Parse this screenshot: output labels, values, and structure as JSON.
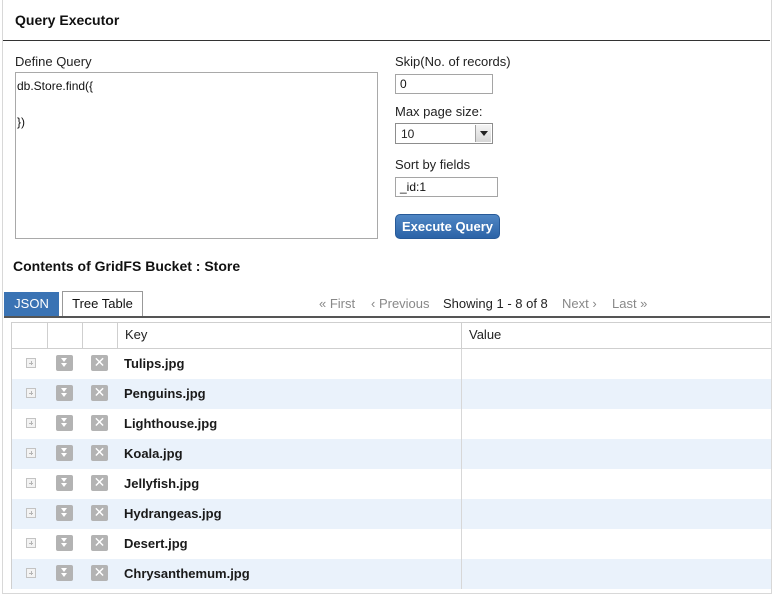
{
  "page": {
    "title": "Query Executor"
  },
  "query": {
    "define_label": "Define Query",
    "text": "db.Store.find({\n\n})",
    "skip_label": "Skip(No. of records)",
    "skip_value": "0",
    "max_page_label": "Max page size:",
    "max_page_value": "10",
    "sort_label": "Sort by fields",
    "sort_value": "_id:1",
    "execute_label": "Execute Query"
  },
  "results": {
    "section_title": "Contents of GridFS Bucket : Store",
    "tabs": [
      {
        "label": "JSON",
        "active": true
      },
      {
        "label": "Tree Table",
        "active": false
      }
    ],
    "pager": {
      "first": "« First",
      "previous": "‹ Previous",
      "status": "Showing 1 - 8 of 8",
      "next": "Next ›",
      "last": "Last »"
    },
    "columns": {
      "key": "Key",
      "value": "Value"
    },
    "rows": [
      {
        "key": "Tulips.jpg",
        "value": ""
      },
      {
        "key": "Penguins.jpg",
        "value": ""
      },
      {
        "key": "Lighthouse.jpg",
        "value": ""
      },
      {
        "key": "Koala.jpg",
        "value": ""
      },
      {
        "key": "Jellyfish.jpg",
        "value": ""
      },
      {
        "key": "Hydrangeas.jpg",
        "value": ""
      },
      {
        "key": "Desert.jpg",
        "value": ""
      },
      {
        "key": "Chrysanthemum.jpg",
        "value": ""
      }
    ],
    "row_icons": {
      "expand": "expand-icon",
      "download": "download-icon",
      "delete": "delete-icon",
      "delete_glyph": "✕"
    }
  },
  "colors": {
    "accent": "#3a73b4",
    "row_alt": "#eaf2fb",
    "icon_gray": "#b3b3b3"
  }
}
